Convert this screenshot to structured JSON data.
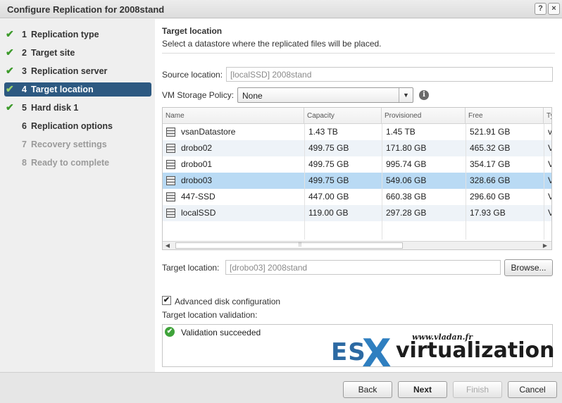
{
  "window": {
    "title": "Configure Replication for 2008stand",
    "help_label": "?",
    "close_label": "×"
  },
  "steps": [
    {
      "num": "1",
      "label": "Replication type",
      "state": "done"
    },
    {
      "num": "2",
      "label": "Target site",
      "state": "done"
    },
    {
      "num": "3",
      "label": "Replication server",
      "state": "done"
    },
    {
      "num": "4",
      "label": "Target location",
      "state": "active"
    },
    {
      "num": "5",
      "label": "Hard disk 1",
      "state": "done"
    },
    {
      "num": "6",
      "label": "Replication options",
      "state": "pending"
    },
    {
      "num": "7",
      "label": "Recovery settings",
      "state": "future"
    },
    {
      "num": "8",
      "label": "Ready to complete",
      "state": "future"
    }
  ],
  "page": {
    "title": "Target location",
    "subtitle": "Select a datastore where the replicated files will be placed."
  },
  "source_location": {
    "label": "Source location:",
    "value": "[localSSD] 2008stand"
  },
  "storage_policy": {
    "label": "VM Storage Policy:",
    "value": "None"
  },
  "datastore_grid": {
    "columns": [
      "Name",
      "Capacity",
      "Provisioned",
      "Free",
      "Ty"
    ],
    "rows": [
      {
        "name": "vsanDatastore",
        "capacity": "1.43 TB",
        "provisioned": "1.45 TB",
        "free": "521.91 GB",
        "type": "v"
      },
      {
        "name": "drobo02",
        "capacity": "499.75 GB",
        "provisioned": "171.80 GB",
        "free": "465.32 GB",
        "type": "V"
      },
      {
        "name": "drobo01",
        "capacity": "499.75 GB",
        "provisioned": "995.74 GB",
        "free": "354.17 GB",
        "type": "V"
      },
      {
        "name": "drobo03",
        "capacity": "499.75 GB",
        "provisioned": "549.06 GB",
        "free": "328.66 GB",
        "type": "V"
      },
      {
        "name": "447-SSD",
        "capacity": "447.00 GB",
        "provisioned": "660.38 GB",
        "free": "296.60 GB",
        "type": "V"
      },
      {
        "name": "localSSD",
        "capacity": "119.00 GB",
        "provisioned": "297.28 GB",
        "free": "17.93 GB",
        "type": "V"
      }
    ],
    "selected_row": "drobo03",
    "scroll_grip": "⠿"
  },
  "target_location": {
    "label": "Target location:",
    "value": "[drobo03] 2008stand",
    "browse_label": "Browse..."
  },
  "advanced": {
    "label": "Advanced disk configuration",
    "checked": true
  },
  "validation": {
    "label": "Target location validation:",
    "message": "Validation succeeded"
  },
  "watermark": {
    "url": "www.vladan.fr",
    "brand_es": "ES",
    "brand_x": "X",
    "brand_rest": "virtualization"
  },
  "footer": {
    "back": "Back",
    "next": "Next",
    "finish": "Finish",
    "cancel": "Cancel"
  },
  "colors": {
    "active_step_bg": "#2d5981",
    "selected_row_bg": "#b9daf4",
    "check_green": "#3c9a2a"
  }
}
